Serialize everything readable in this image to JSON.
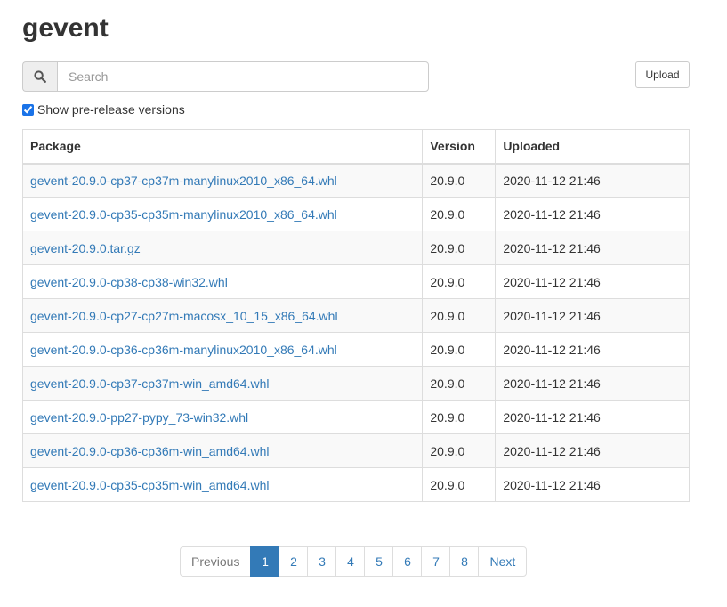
{
  "page": {
    "title": "gevent"
  },
  "search": {
    "placeholder": "Search",
    "value": ""
  },
  "toolbar": {
    "upload_label": "Upload"
  },
  "prerelease": {
    "label": "Show pre-release versions",
    "checked": true
  },
  "table": {
    "headers": {
      "package": "Package",
      "version": "Version",
      "uploaded": "Uploaded"
    },
    "rows": [
      {
        "package": "gevent-20.9.0-cp37-cp37m-manylinux2010_x86_64.whl",
        "version": "20.9.0",
        "uploaded": "2020-11-12 21:46"
      },
      {
        "package": "gevent-20.9.0-cp35-cp35m-manylinux2010_x86_64.whl",
        "version": "20.9.0",
        "uploaded": "2020-11-12 21:46"
      },
      {
        "package": "gevent-20.9.0.tar.gz",
        "version": "20.9.0",
        "uploaded": "2020-11-12 21:46"
      },
      {
        "package": "gevent-20.9.0-cp38-cp38-win32.whl",
        "version": "20.9.0",
        "uploaded": "2020-11-12 21:46"
      },
      {
        "package": "gevent-20.9.0-cp27-cp27m-macosx_10_15_x86_64.whl",
        "version": "20.9.0",
        "uploaded": "2020-11-12 21:46"
      },
      {
        "package": "gevent-20.9.0-cp36-cp36m-manylinux2010_x86_64.whl",
        "version": "20.9.0",
        "uploaded": "2020-11-12 21:46"
      },
      {
        "package": "gevent-20.9.0-cp37-cp37m-win_amd64.whl",
        "version": "20.9.0",
        "uploaded": "2020-11-12 21:46"
      },
      {
        "package": "gevent-20.9.0-pp27-pypy_73-win32.whl",
        "version": "20.9.0",
        "uploaded": "2020-11-12 21:46"
      },
      {
        "package": "gevent-20.9.0-cp36-cp36m-win_amd64.whl",
        "version": "20.9.0",
        "uploaded": "2020-11-12 21:46"
      },
      {
        "package": "gevent-20.9.0-cp35-cp35m-win_amd64.whl",
        "version": "20.9.0",
        "uploaded": "2020-11-12 21:46"
      }
    ]
  },
  "pagination": {
    "previous": "Previous",
    "next": "Next",
    "pages": [
      "1",
      "2",
      "3",
      "4",
      "5",
      "6",
      "7",
      "8"
    ],
    "current": "1"
  },
  "icons": {
    "search": "search-icon"
  },
  "colors": {
    "link": "#337ab7",
    "active_page": "#337ab7"
  }
}
